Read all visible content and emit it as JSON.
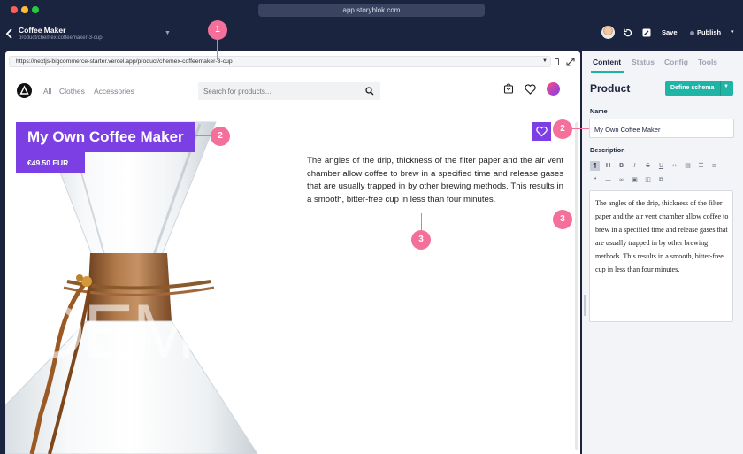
{
  "window": {
    "url": "app.storyblok.com"
  },
  "header": {
    "story_title": "Coffee Maker",
    "story_slug": "product/chemex-coffeemaker-3-cup",
    "save_label": "Save",
    "publish_label": "Publish"
  },
  "preview": {
    "address": "https://nextjs-bigcommerce-starter.vercel.app/product/chemex-coffeemaker-3-cup",
    "nav": [
      "All",
      "Clothes",
      "Accessories"
    ],
    "search_placeholder": "Search for products...",
    "product_title": "My Own Coffee Maker",
    "price": "€49.50 EUR",
    "watermark": "DEMO",
    "description": "The angles of the drip, thickness of the filter paper and the air vent chamber allow coffee to brew in a specified time and release gases that are usually trapped in by other brewing methods. This results in a smooth, bitter-free cup in less than four minutes."
  },
  "panel": {
    "tabs": [
      "Content",
      "Status",
      "Config",
      "Tools"
    ],
    "active_tab": "Content",
    "heading": "Product",
    "define_schema_label": "Define schema",
    "name_label": "Name",
    "name_value": "My Own Coffee Maker",
    "description_label": "Description",
    "description_value": "The angles of the drip, thickness of the filter paper and the air vent chamber allow coffee to brew in a specified time and release gases that are usually trapped in by other brewing methods. This results in a smooth, bitter-free cup in less than four minutes.",
    "toolbar_row1": [
      "paragraph-icon",
      "heading-icon",
      "bold-icon",
      "italic-icon",
      "strike-icon",
      "underline-icon",
      "code-icon",
      "code-block-icon",
      "bullet-list-icon",
      "ordered-list-icon"
    ],
    "toolbar_row2": [
      "quote-icon",
      "hr-icon",
      "link-icon",
      "image-icon",
      "blok-icon",
      "paste-icon"
    ]
  },
  "markers": [
    "1",
    "2",
    "3",
    "2",
    "3"
  ],
  "colors": {
    "accent": "#7b3fe4",
    "teal": "#1fb5a6",
    "marker": "#f4709b",
    "chrome": "#1b243f"
  }
}
